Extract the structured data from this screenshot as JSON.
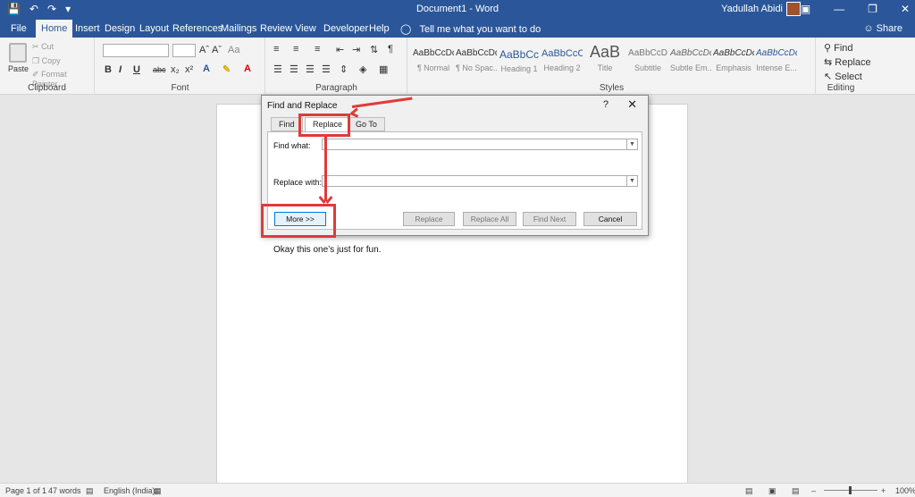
{
  "titlebar": {
    "doc_title": "Document1  -  Word",
    "user_name": "Yadullah Abidi",
    "qat_icons": [
      "save-icon",
      "undo-icon",
      "redo-icon",
      "customize-icon"
    ],
    "bg_color": "#2b579a"
  },
  "tabs": [
    {
      "label": "File"
    },
    {
      "label": "Home"
    },
    {
      "label": "Insert"
    },
    {
      "label": "Design"
    },
    {
      "label": "Layout"
    },
    {
      "label": "References"
    },
    {
      "label": "Mailings"
    },
    {
      "label": "Review"
    },
    {
      "label": "View"
    },
    {
      "label": "Developer"
    },
    {
      "label": "Help"
    }
  ],
  "active_tab": "Home",
  "tell_me": "Tell me what you want to do",
  "share_label": "Share",
  "clipboard": {
    "paste": "Paste",
    "cut": "Cut",
    "copy": "Copy",
    "format_painter": "Format Painter",
    "label": "Clipboard"
  },
  "font": {
    "grow": "Aˆ",
    "shrink": "Aˇ",
    "case": "Aa",
    "bold": "B",
    "italic": "I",
    "underline": "U",
    "strike": "abc",
    "sub": "x₂",
    "sup": "x²",
    "label": "Font"
  },
  "paragraph": {
    "label": "Paragraph",
    "pilcrow": "¶"
  },
  "styles": {
    "label": "Styles",
    "items": [
      {
        "sample": "AaBbCcDd",
        "name": "¶ Normal"
      },
      {
        "sample": "AaBbCcDd",
        "name": "¶ No Spac..."
      },
      {
        "sample": "AaBbCc",
        "name": "Heading 1"
      },
      {
        "sample": "AaBbCcC",
        "name": "Heading 2"
      },
      {
        "sample": "AaB",
        "name": "Title"
      },
      {
        "sample": "AaBbCcD",
        "name": "Subtitle"
      },
      {
        "sample": "AaBbCcDd",
        "name": "Subtle Em..."
      },
      {
        "sample": "AaBbCcDd",
        "name": "Emphasis"
      },
      {
        "sample": "AaBbCcDd",
        "name": "Intense E..."
      }
    ]
  },
  "editing": {
    "find": "Find",
    "replace": "Replace",
    "select": "Select",
    "label": "Editing"
  },
  "document": {
    "text": "Okay this one’s just for fun."
  },
  "dialog": {
    "title": "Find and Replace",
    "help": "?",
    "close": "✕",
    "tabs": [
      "Find",
      "Replace",
      "Go To"
    ],
    "active_tab": "Replace",
    "find_label": "Find what:",
    "find_value": "",
    "replace_label": "Replace with:",
    "replace_value": "",
    "buttons": {
      "more": "More >>",
      "replace": "Replace",
      "replace_all": "Replace All",
      "find_next": "Find Next",
      "cancel": "Cancel"
    },
    "highlight_color": "#e03a3a"
  },
  "status": {
    "page": "Page 1 of 1",
    "words": "47 words",
    "language": "English (India)",
    "zoom": "100%"
  }
}
